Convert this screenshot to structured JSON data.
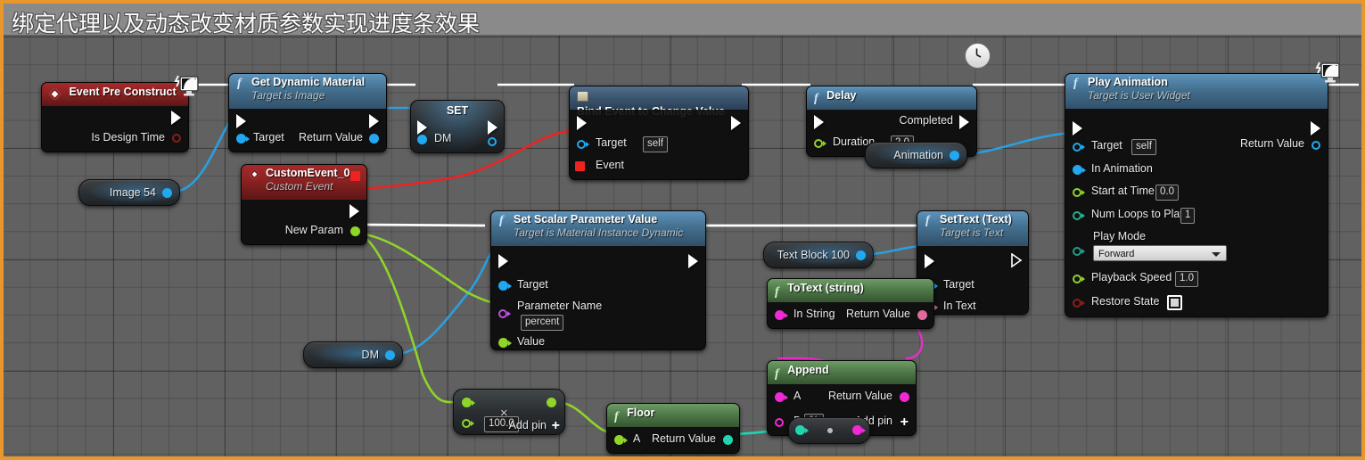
{
  "window": {
    "title": "绑定代理以及动态改变材质参数实现进度条效果",
    "accent_color": "#e8972c",
    "titlebar_color": "#8a8a8a",
    "canvas_color": "#616161"
  },
  "nodes": {
    "event_pre_construct": {
      "title": "Event Pre Construct",
      "icon": "event-diamond-icon",
      "badge": "monitor-icon",
      "out_exec": "",
      "pins": [
        {
          "label": "Is Design Time",
          "type": "boolean",
          "color": "#8c1c1c"
        }
      ]
    },
    "get_dynamic_material": {
      "title": "Get Dynamic Material",
      "subtitle": "Target is Image",
      "icon": "function-f-icon",
      "in_pins": [
        {
          "label": "Target",
          "color": "#22a8f0"
        }
      ],
      "out_pins": [
        {
          "label": "Return Value",
          "color": "#22a8f0"
        }
      ]
    },
    "set_dm": {
      "title": "SET",
      "in_pins": [
        {
          "label": "DM",
          "color": "#22a8f0"
        }
      ]
    },
    "bind_event": {
      "title": "Bind Event to Change Value",
      "icon": "delegate-icon",
      "pins": [
        {
          "label": "Target",
          "value": "self",
          "color": "#22a8f0"
        },
        {
          "label": "Event",
          "color": "#ef2222"
        }
      ]
    },
    "delay": {
      "title": "Delay",
      "icon": "function-f-icon",
      "badge": "clock-icon",
      "out_exec_label": "Completed",
      "pins": [
        {
          "label": "Duration",
          "value": "2.0",
          "color": "#8fd42a"
        }
      ]
    },
    "play_animation": {
      "title": "Play Animation",
      "subtitle": "Target is User Widget",
      "icon": "function-f-icon",
      "badge": "monitor-icon",
      "pins": [
        {
          "label": "Target",
          "value": "self",
          "color": "#22a8f0"
        },
        {
          "label": "In Animation",
          "color": "#22a8f0"
        },
        {
          "label": "Start at Time",
          "value": "0.0",
          "color": "#8fd42a"
        },
        {
          "label": "Num Loops to Play",
          "value": "1",
          "color": "#25b08b"
        },
        {
          "label": "Play Mode",
          "value": "Forward",
          "color": "#1f9e86"
        },
        {
          "label": "Playback Speed",
          "value": "1.0",
          "color": "#8fd42a"
        },
        {
          "label": "Restore State",
          "value": "",
          "color": "#8c1c1c"
        }
      ],
      "out_pins": [
        {
          "label": "Return Value",
          "color": "#22a8f0"
        }
      ]
    },
    "custom_event": {
      "title": "CustomEvent_0",
      "subtitle": "Custom Event",
      "icon": "event-diamond-icon",
      "out_pins": [
        {
          "label": "New Param",
          "color": "#8fd42a"
        }
      ]
    },
    "set_scalar": {
      "title": "Set Scalar Parameter Value",
      "subtitle": "Target is Material Instance Dynamic",
      "icon": "function-f-icon",
      "pins": [
        {
          "label": "Target",
          "color": "#22a8f0"
        },
        {
          "label": "Parameter Name",
          "value": "percent",
          "color": "#c04fe0"
        },
        {
          "label": "Value",
          "color": "#8fd42a"
        }
      ]
    },
    "set_text": {
      "title": "SetText (Text)",
      "subtitle": "Target is Text",
      "icon": "function-f-icon",
      "pins": [
        {
          "label": "Target",
          "color": "#22a8f0"
        },
        {
          "label": "In Text",
          "color": "#e06a9c"
        }
      ]
    },
    "to_text": {
      "title": "ToText (string)",
      "icon": "function-f-icon",
      "in_pins": [
        {
          "label": "In String",
          "color": "#ef2ad4"
        }
      ],
      "out_pins": [
        {
          "label": "Return Value",
          "color": "#e06a9c"
        }
      ]
    },
    "append": {
      "title": "Append",
      "icon": "function-f-icon",
      "in_pins": [
        {
          "label": "A",
          "color": "#ef2ad4"
        },
        {
          "label": "B",
          "value": "%",
          "color": "#ef2ad4"
        }
      ],
      "out_pins": [
        {
          "label": "Return Value",
          "color": "#ef2ad4"
        }
      ],
      "add_pin_label": "Add pin"
    },
    "multiply": {
      "title": "",
      "operator": "×",
      "value": "100.0",
      "add_pin_label": "Add pin"
    },
    "floor": {
      "title": "Floor",
      "icon": "function-f-icon",
      "in_pins": [
        {
          "label": "A",
          "color": "#8fd42a"
        }
      ],
      "out_pins": [
        {
          "label": "Return Value",
          "color": "#1fd6b0"
        }
      ]
    },
    "int_to_string": {
      "title": "",
      "in_color": "#1fd6b0",
      "out_color": "#ef2ad4"
    },
    "var_image54": {
      "label": "Image 54",
      "color": "#22a8f0"
    },
    "var_animation": {
      "label": "Animation",
      "color": "#22a8f0"
    },
    "var_dm": {
      "label": "DM",
      "color": "#22a8f0"
    },
    "var_textblock100": {
      "label": "Text Block 100",
      "color": "#22a8f0"
    }
  },
  "wire_colors": {
    "exec": "#ffffff",
    "object": "#2a9fe0",
    "delegate": "#ef2222",
    "float": "#8fd42a",
    "int": "#1fd6b0",
    "string": "#ef2ad4",
    "text": "#e06a9c"
  }
}
